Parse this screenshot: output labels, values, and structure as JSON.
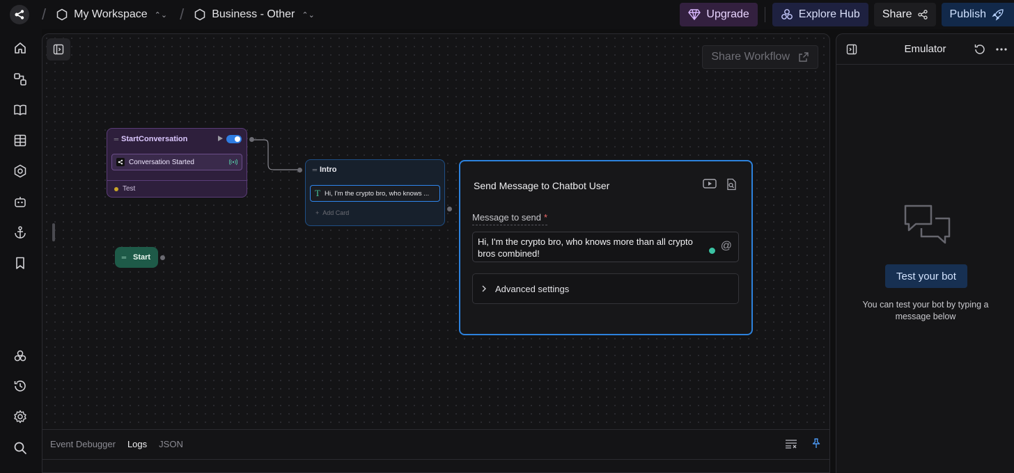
{
  "header": {
    "workspace": "My Workspace",
    "project": "Business - Other",
    "upgrade": "Upgrade",
    "explore_hub": "Explore Hub",
    "share": "Share",
    "publish": "Publish"
  },
  "rail": {
    "icons": [
      "home-icon",
      "flows-icon",
      "knowledge-icon",
      "tables-icon",
      "hub-icon",
      "bot-icon",
      "anchor-icon",
      "bookmark-icon",
      "integrations-icon",
      "history-icon",
      "settings-icon",
      "search-icon"
    ]
  },
  "canvas": {
    "share_workflow": "Share Workflow",
    "nodes": {
      "start_conversation": {
        "title": "StartConversation",
        "card": "Conversation Started",
        "footer": "Test",
        "enabled": true
      },
      "start": {
        "label": "Start"
      },
      "intro": {
        "title": "Intro",
        "card_text": "Hi, I'm the crypto bro, who knows ...",
        "add_card": "Add Card"
      }
    }
  },
  "send_message": {
    "title": "Send Message to Chatbot User",
    "field_label": "Message to send",
    "required_mark": "*",
    "message": "Hi, I'm the crypto bro, who knows more than all crypto bros combined!",
    "advanced": "Advanced settings"
  },
  "debugger": {
    "tabs": [
      {
        "label": "Event Debugger",
        "active": false
      },
      {
        "label": "Logs",
        "active": true
      },
      {
        "label": "JSON",
        "active": false
      }
    ]
  },
  "emulator": {
    "title": "Emulator",
    "test_button": "Test your bot",
    "description": "You can test your bot by typing a message below"
  },
  "colors": {
    "accent_blue": "#2d82dd",
    "start_conversation_node": "#2e1f3c",
    "start_node": "#1e5a48",
    "upgrade_bg": "#33203f"
  }
}
